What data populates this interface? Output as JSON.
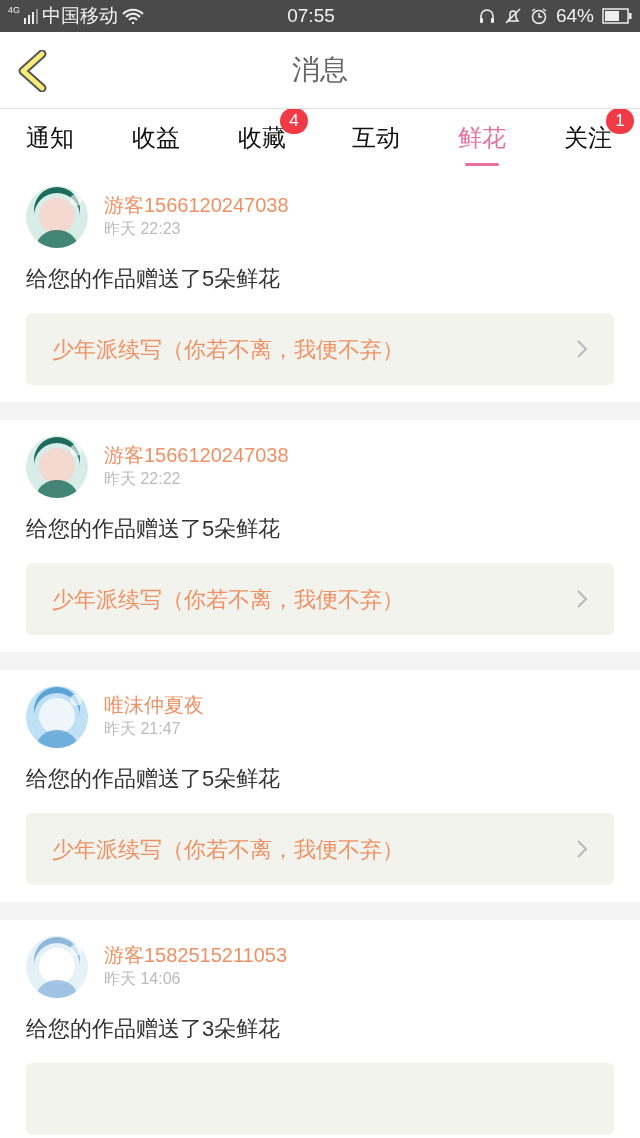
{
  "status_bar": {
    "network": "4G",
    "carrier": "中国移动",
    "time": "07:55",
    "battery": "64%"
  },
  "header": {
    "title": "消息"
  },
  "tabs": [
    {
      "label": "通知",
      "selected": false
    },
    {
      "label": "收益",
      "selected": false
    },
    {
      "label": "收藏",
      "selected": false,
      "badge": "4"
    },
    {
      "label": "互动",
      "selected": false
    },
    {
      "label": "鲜花",
      "selected": true
    },
    {
      "label": "关注",
      "selected": false,
      "badge": "1"
    }
  ],
  "messages": [
    {
      "user": "游客1566120247038",
      "time": "昨天 22:23",
      "text": "给您的作品赠送了5朵鲜花",
      "work": "少年派续写（你若不离，我便不弃）"
    },
    {
      "user": "游客1566120247038",
      "time": "昨天 22:22",
      "text": "给您的作品赠送了5朵鲜花",
      "work": "少年派续写（你若不离，我便不弃）"
    },
    {
      "user": "唯沫仲夏夜",
      "time": "昨天 21:47",
      "text": "给您的作品赠送了5朵鲜花",
      "work": "少年派续写（你若不离，我便不弃）"
    },
    {
      "user": "游客1582515211053",
      "time": "昨天 14:06",
      "text": "给您的作品赠送了3朵鲜花"
    }
  ]
}
